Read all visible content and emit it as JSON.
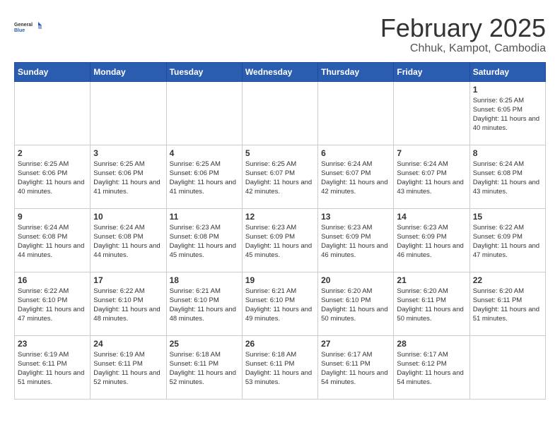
{
  "logo": {
    "general": "General",
    "blue": "Blue"
  },
  "header": {
    "title": "February 2025",
    "subtitle": "Chhuk, Kampot, Cambodia"
  },
  "days_of_week": [
    "Sunday",
    "Monday",
    "Tuesday",
    "Wednesday",
    "Thursday",
    "Friday",
    "Saturday"
  ],
  "weeks": [
    [
      {
        "day": "",
        "info": ""
      },
      {
        "day": "",
        "info": ""
      },
      {
        "day": "",
        "info": ""
      },
      {
        "day": "",
        "info": ""
      },
      {
        "day": "",
        "info": ""
      },
      {
        "day": "",
        "info": ""
      },
      {
        "day": "1",
        "info": "Sunrise: 6:25 AM\nSunset: 6:05 PM\nDaylight: 11 hours and 40 minutes."
      }
    ],
    [
      {
        "day": "2",
        "info": "Sunrise: 6:25 AM\nSunset: 6:06 PM\nDaylight: 11 hours and 40 minutes."
      },
      {
        "day": "3",
        "info": "Sunrise: 6:25 AM\nSunset: 6:06 PM\nDaylight: 11 hours and 41 minutes."
      },
      {
        "day": "4",
        "info": "Sunrise: 6:25 AM\nSunset: 6:06 PM\nDaylight: 11 hours and 41 minutes."
      },
      {
        "day": "5",
        "info": "Sunrise: 6:25 AM\nSunset: 6:07 PM\nDaylight: 11 hours and 42 minutes."
      },
      {
        "day": "6",
        "info": "Sunrise: 6:24 AM\nSunset: 6:07 PM\nDaylight: 11 hours and 42 minutes."
      },
      {
        "day": "7",
        "info": "Sunrise: 6:24 AM\nSunset: 6:07 PM\nDaylight: 11 hours and 43 minutes."
      },
      {
        "day": "8",
        "info": "Sunrise: 6:24 AM\nSunset: 6:08 PM\nDaylight: 11 hours and 43 minutes."
      }
    ],
    [
      {
        "day": "9",
        "info": "Sunrise: 6:24 AM\nSunset: 6:08 PM\nDaylight: 11 hours and 44 minutes."
      },
      {
        "day": "10",
        "info": "Sunrise: 6:24 AM\nSunset: 6:08 PM\nDaylight: 11 hours and 44 minutes."
      },
      {
        "day": "11",
        "info": "Sunrise: 6:23 AM\nSunset: 6:08 PM\nDaylight: 11 hours and 45 minutes."
      },
      {
        "day": "12",
        "info": "Sunrise: 6:23 AM\nSunset: 6:09 PM\nDaylight: 11 hours and 45 minutes."
      },
      {
        "day": "13",
        "info": "Sunrise: 6:23 AM\nSunset: 6:09 PM\nDaylight: 11 hours and 46 minutes."
      },
      {
        "day": "14",
        "info": "Sunrise: 6:23 AM\nSunset: 6:09 PM\nDaylight: 11 hours and 46 minutes."
      },
      {
        "day": "15",
        "info": "Sunrise: 6:22 AM\nSunset: 6:09 PM\nDaylight: 11 hours and 47 minutes."
      }
    ],
    [
      {
        "day": "16",
        "info": "Sunrise: 6:22 AM\nSunset: 6:10 PM\nDaylight: 11 hours and 47 minutes."
      },
      {
        "day": "17",
        "info": "Sunrise: 6:22 AM\nSunset: 6:10 PM\nDaylight: 11 hours and 48 minutes."
      },
      {
        "day": "18",
        "info": "Sunrise: 6:21 AM\nSunset: 6:10 PM\nDaylight: 11 hours and 48 minutes."
      },
      {
        "day": "19",
        "info": "Sunrise: 6:21 AM\nSunset: 6:10 PM\nDaylight: 11 hours and 49 minutes."
      },
      {
        "day": "20",
        "info": "Sunrise: 6:20 AM\nSunset: 6:10 PM\nDaylight: 11 hours and 50 minutes."
      },
      {
        "day": "21",
        "info": "Sunrise: 6:20 AM\nSunset: 6:11 PM\nDaylight: 11 hours and 50 minutes."
      },
      {
        "day": "22",
        "info": "Sunrise: 6:20 AM\nSunset: 6:11 PM\nDaylight: 11 hours and 51 minutes."
      }
    ],
    [
      {
        "day": "23",
        "info": "Sunrise: 6:19 AM\nSunset: 6:11 PM\nDaylight: 11 hours and 51 minutes."
      },
      {
        "day": "24",
        "info": "Sunrise: 6:19 AM\nSunset: 6:11 PM\nDaylight: 11 hours and 52 minutes."
      },
      {
        "day": "25",
        "info": "Sunrise: 6:18 AM\nSunset: 6:11 PM\nDaylight: 11 hours and 52 minutes."
      },
      {
        "day": "26",
        "info": "Sunrise: 6:18 AM\nSunset: 6:11 PM\nDaylight: 11 hours and 53 minutes."
      },
      {
        "day": "27",
        "info": "Sunrise: 6:17 AM\nSunset: 6:11 PM\nDaylight: 11 hours and 54 minutes."
      },
      {
        "day": "28",
        "info": "Sunrise: 6:17 AM\nSunset: 6:12 PM\nDaylight: 11 hours and 54 minutes."
      },
      {
        "day": "",
        "info": ""
      }
    ]
  ]
}
